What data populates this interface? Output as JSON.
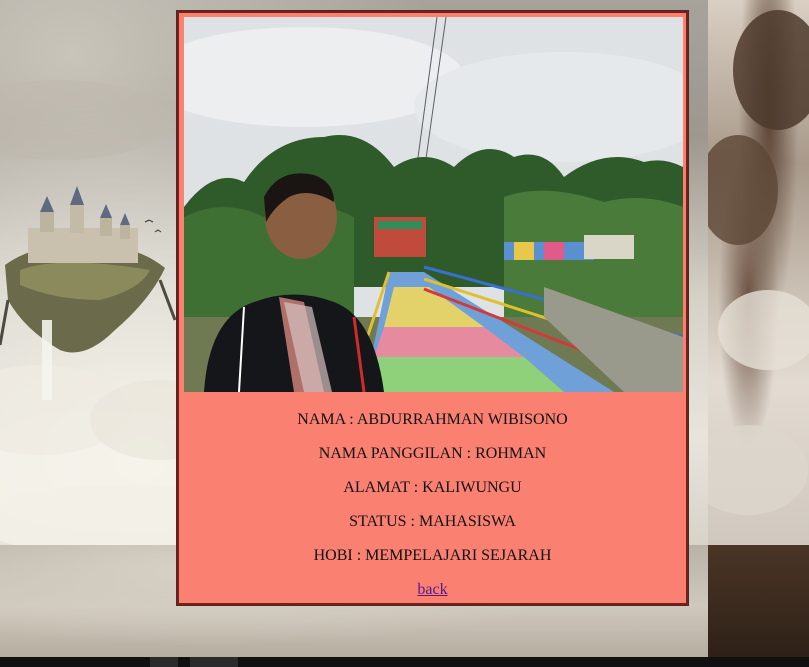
{
  "profile": {
    "photo_icon": "profile-photo",
    "fields": [
      "NAMA : ABDURRAHMAN WIBISONO",
      "NAMA PANGGILAN : ROHMAN",
      "ALAMAT : KALIWUNGU",
      "STATUS : MAHASISWA",
      "HOBI : MEMPELAJARI SEJARAH"
    ],
    "back_label": "back"
  },
  "colors": {
    "card_background": "#fa8072",
    "card_border": "#7a1f18",
    "link": "#551a8b"
  }
}
